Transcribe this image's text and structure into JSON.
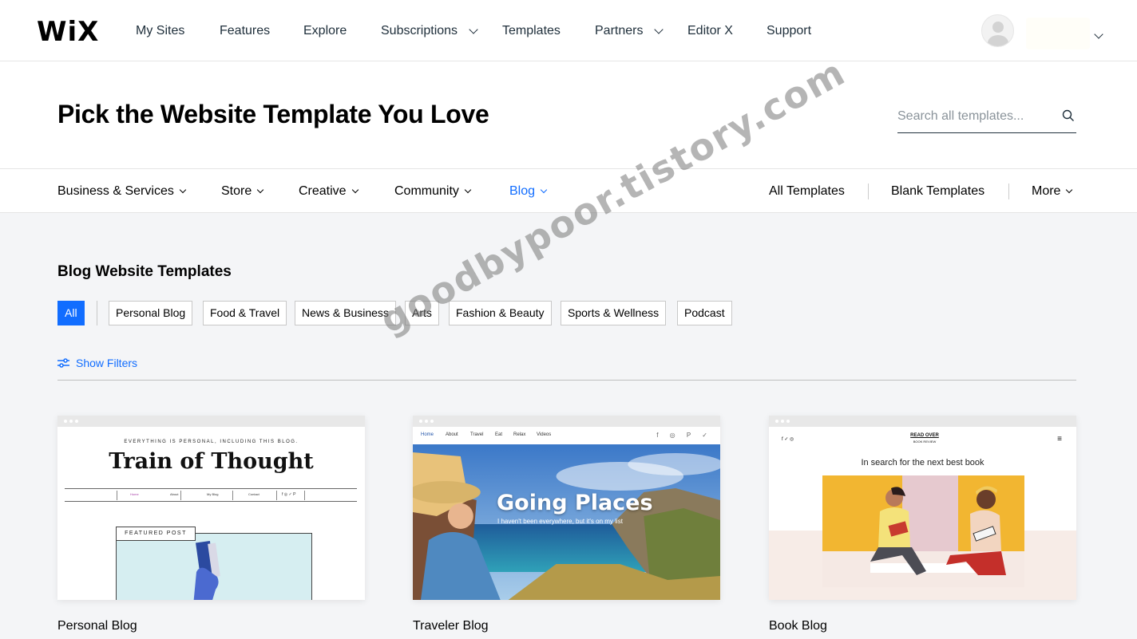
{
  "brand": {
    "logo": "WiX"
  },
  "topnav": {
    "items": [
      {
        "label": "My Sites"
      },
      {
        "label": "Features"
      },
      {
        "label": "Explore"
      },
      {
        "label": "Subscriptions"
      },
      {
        "label": "Templates"
      },
      {
        "label": "Partners"
      },
      {
        "label": "Editor X"
      },
      {
        "label": "Support"
      }
    ]
  },
  "hero": {
    "title": "Pick the Website Template You Love",
    "search_placeholder": "Search all templates..."
  },
  "categories": {
    "left": [
      {
        "label": "Business & Services"
      },
      {
        "label": "Store"
      },
      {
        "label": "Creative"
      },
      {
        "label": "Community"
      },
      {
        "label": "Blog"
      }
    ],
    "right": [
      {
        "label": "All Templates"
      },
      {
        "label": "Blank Templates"
      },
      {
        "label": "More"
      }
    ],
    "active": "Blog",
    "active_color": "#116dff"
  },
  "section": {
    "title": "Blog Website Templates",
    "chips": [
      "All",
      "Personal Blog",
      "Food & Travel",
      "News & Business",
      "Arts",
      "Fashion & Beauty",
      "Sports & Wellness",
      "Podcast"
    ],
    "selected_chip": "All",
    "show_filters": "Show Filters"
  },
  "cards": [
    {
      "label": "Personal Blog",
      "preview": {
        "tagline": "EVERYTHING IS PERSONAL, INCLUDING THIS BLOG.",
        "title": "Train of Thought",
        "menu": [
          "Home",
          "About",
          "My Blog",
          "Contact"
        ],
        "featured": "FEATURED POST"
      }
    },
    {
      "label": "Traveler Blog",
      "preview": {
        "menu": [
          "Home",
          "About",
          "Travel",
          "Eat",
          "Relax",
          "Videos"
        ],
        "social": "f ◎ P ✓",
        "title": "Going Places",
        "subtitle": "I haven't been everywhere, but it's on my list"
      }
    },
    {
      "label": "Book Blog",
      "preview": {
        "social": "f ✓ ◎",
        "logo_line1": "READ OVER",
        "logo_line2": "BOOK REVIEW",
        "tagline": "In search for the next best book"
      }
    }
  ],
  "watermark": "goodbypoor.tistory.com"
}
